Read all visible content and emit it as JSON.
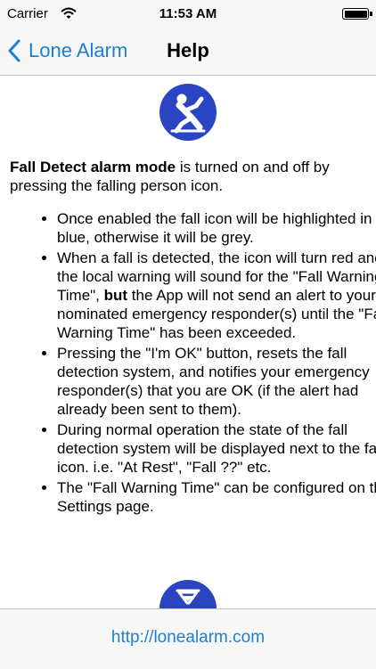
{
  "status_bar": {
    "carrier": "Carrier",
    "time": "11:53 AM",
    "battery_level": 1.0
  },
  "nav": {
    "back_label": "Lone Alarm",
    "title": "Help"
  },
  "icons": {
    "fall_icon": "falling-person-icon",
    "hourglass_icon": "hourglass-icon",
    "accent_color": "#2a44c2"
  },
  "intro": {
    "bold": "Fall Detect alarm mode",
    "rest": " is turned on and off by pressing the falling person icon."
  },
  "bullets": {
    "b1": "Once enabled the fall icon will be highlighted in blue, otherwise it will be grey.",
    "b2_pre": "When a fall is detected, the icon will turn red and the local warning will sound for the \"Fall Warning Time\", ",
    "b2_bold": "but",
    "b2_post": " the App will not send an alert to your nominated emergency responder(s) until the \"Fall Warning Time\" has been exceeded.",
    "b3": "Pressing the \"I'm OK\" button, resets the fall detection system, and notifies your emergency responder(s) that you are OK (if the alert had already been sent to them).",
    "b4": "During normal operation the state of the fall detection system will be displayed next to the fall icon. i.e. \"At Rest\", \"Fall ??\" etc.",
    "b5": "The \"Fall Warning Time\" can be configured on the Settings page."
  },
  "footer": {
    "link": "http://lonealarm.com"
  },
  "colors": {
    "link": "#1f7fcf",
    "bar_bg": "#f7f7f7"
  }
}
